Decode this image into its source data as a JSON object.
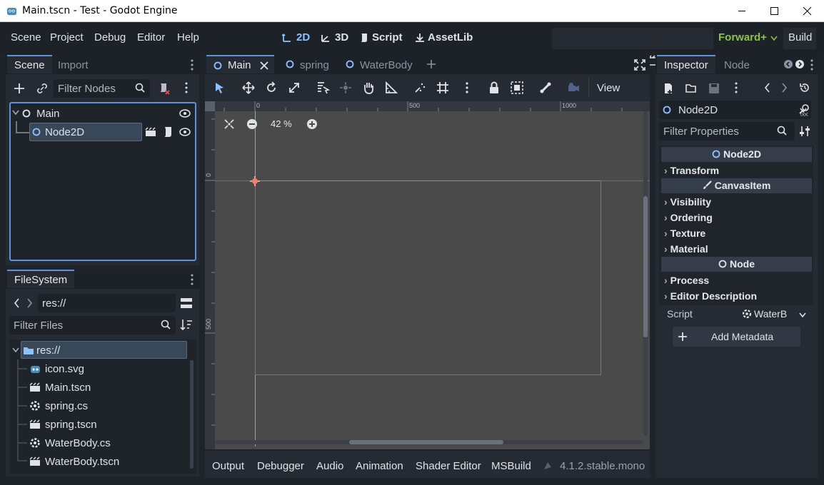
{
  "window": {
    "title": "Main.tscn - Test - Godot Engine",
    "controls": [
      "minimize",
      "maximize",
      "close"
    ]
  },
  "menubar": {
    "items": [
      "Scene",
      "Project",
      "Debug",
      "Editor",
      "Help"
    ],
    "workspaces": [
      {
        "label": "2D",
        "icon": "node2d-icon",
        "active": true
      },
      {
        "label": "3D",
        "icon": "node3d-icon",
        "active": false
      },
      {
        "label": "Script",
        "icon": "script-icon",
        "active": false
      },
      {
        "label": "AssetLib",
        "icon": "download-icon",
        "active": false
      }
    ],
    "renderer": "Forward+",
    "build_label": "Build"
  },
  "scene_dock": {
    "tabs": [
      "Scene",
      "Import"
    ],
    "filter_placeholder": "Filter Nodes",
    "tree": [
      {
        "label": "Main",
        "level": 0,
        "selected": false
      },
      {
        "label": "Node2D",
        "level": 1,
        "selected": true
      }
    ]
  },
  "filesystem_dock": {
    "tab": "FileSystem",
    "path": "res://",
    "filter_placeholder": "Filter Files",
    "root": "res://",
    "files": [
      {
        "name": "icon.svg",
        "icon": "image-icon"
      },
      {
        "name": "Main.tscn",
        "icon": "scene-icon"
      },
      {
        "name": "spring.cs",
        "icon": "csharp-icon"
      },
      {
        "name": "spring.tscn",
        "icon": "scene-icon"
      },
      {
        "name": "WaterBody.cs",
        "icon": "csharp-icon"
      },
      {
        "name": "WaterBody.tscn",
        "icon": "scene-icon"
      }
    ]
  },
  "editor": {
    "tabs": [
      {
        "label": "Main",
        "active": true
      },
      {
        "label": "spring",
        "active": false
      },
      {
        "label": "WaterBody",
        "active": false
      }
    ],
    "view_label": "View",
    "zoom": "42 %",
    "ruler_top": [
      "0",
      "500",
      "1000"
    ],
    "ruler_left": [
      "0",
      "500"
    ]
  },
  "bottom_panel": {
    "tabs": [
      "Output",
      "Debugger",
      "Audio",
      "Animation",
      "Shader Editor",
      "MSBuild"
    ],
    "version": "4.1.2.stable.mono"
  },
  "inspector": {
    "tabs": [
      "Inspector",
      "Node"
    ],
    "node_type": "Node2D",
    "filter_placeholder": "Filter Properties",
    "sections": [
      {
        "kind": "header",
        "label": "Node2D",
        "icon": "node2d-circle-icon"
      },
      {
        "kind": "group",
        "label": "Transform"
      },
      {
        "kind": "header",
        "label": "CanvasItem",
        "icon": "brush-icon"
      },
      {
        "kind": "group",
        "label": "Visibility"
      },
      {
        "kind": "group",
        "label": "Ordering"
      },
      {
        "kind": "group",
        "label": "Texture"
      },
      {
        "kind": "group",
        "label": "Material"
      },
      {
        "kind": "header",
        "label": "Node",
        "icon": "node-circle-icon"
      },
      {
        "kind": "group",
        "label": "Process"
      },
      {
        "kind": "group",
        "label": "Editor Description"
      }
    ],
    "script_label": "Script",
    "script_value": "WaterB",
    "add_metadata_label": "Add Metadata"
  },
  "colors": {
    "accent": "#5f91d8",
    "renderer_green": "#8bc34a",
    "axis_x": "#d64545",
    "axis_y": "#8fc33a",
    "viewport": "#4a4a4a"
  }
}
